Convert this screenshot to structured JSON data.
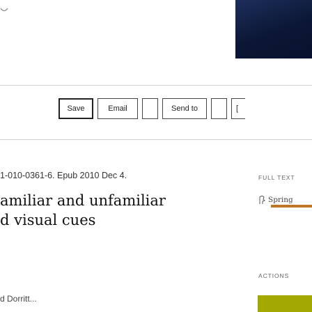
{
  "toolbar": {
    "buttons": [
      {
        "label": "Save"
      },
      {
        "label": "Email"
      },
      {
        "label": ""
      },
      {
        "label": "Send to"
      },
      {
        "label": ""
      },
      {
        "label": "["
      }
    ]
  },
  "article": {
    "citation": "1-010-0361-6. Epub 2010 Dec 4.",
    "title_line1": "amiliar and unfamiliar",
    "title_line2": "d visual cues",
    "authors": "d   Dorritt..."
  },
  "sidebar": {
    "full_text_label": "FULL TEXT",
    "full_text_provider": "Spring",
    "actions_label": "ACTIONS"
  },
  "colors": {
    "top_image": "#0d1b3d",
    "springer_accent": "#c0762a",
    "action_button": "#a3a900"
  }
}
